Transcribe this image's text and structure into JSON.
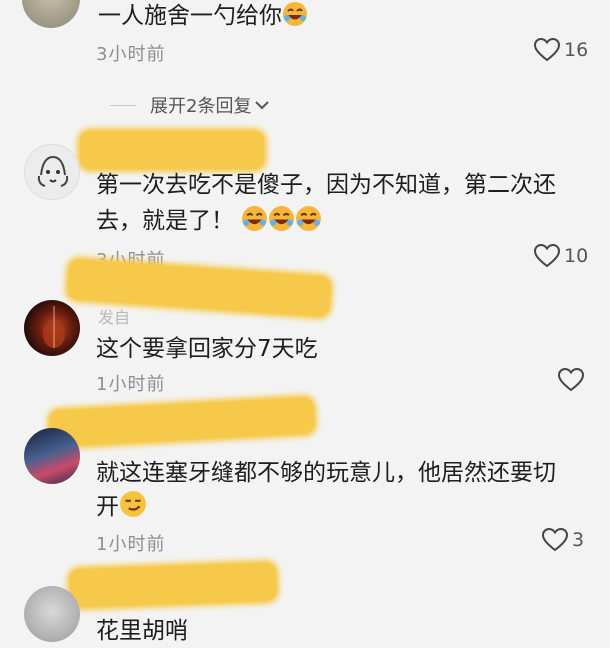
{
  "comments": [
    {
      "text": "一人施舍一勺给你",
      "emoji": "laughing-emoji",
      "time": "3小时前",
      "likes": "16"
    },
    {
      "line1": "第一次去吃不是傻子，因为不知道，第二次还",
      "line2": "去，就是了！",
      "emoji": "laughing-emoji",
      "time": "3小时前",
      "likes": "10"
    },
    {
      "username_partial": "发自",
      "text": "这个要拿回家分7天吃",
      "time": "1小时前",
      "likes": ""
    },
    {
      "line1": "就这连塞牙缝都不够的玩意儿，他居然还要切",
      "line2": "开",
      "emoji": "smirk-emoji",
      "time": "1小时前",
      "likes": "3"
    },
    {
      "text": "花里胡哨"
    }
  ],
  "replies": {
    "label": "展开2条回复",
    "icon": "chevron-down-icon"
  },
  "colors": {
    "redaction": "#f6c94a",
    "background": "#f3f3f3",
    "meta_text": "#8e8e8e"
  }
}
